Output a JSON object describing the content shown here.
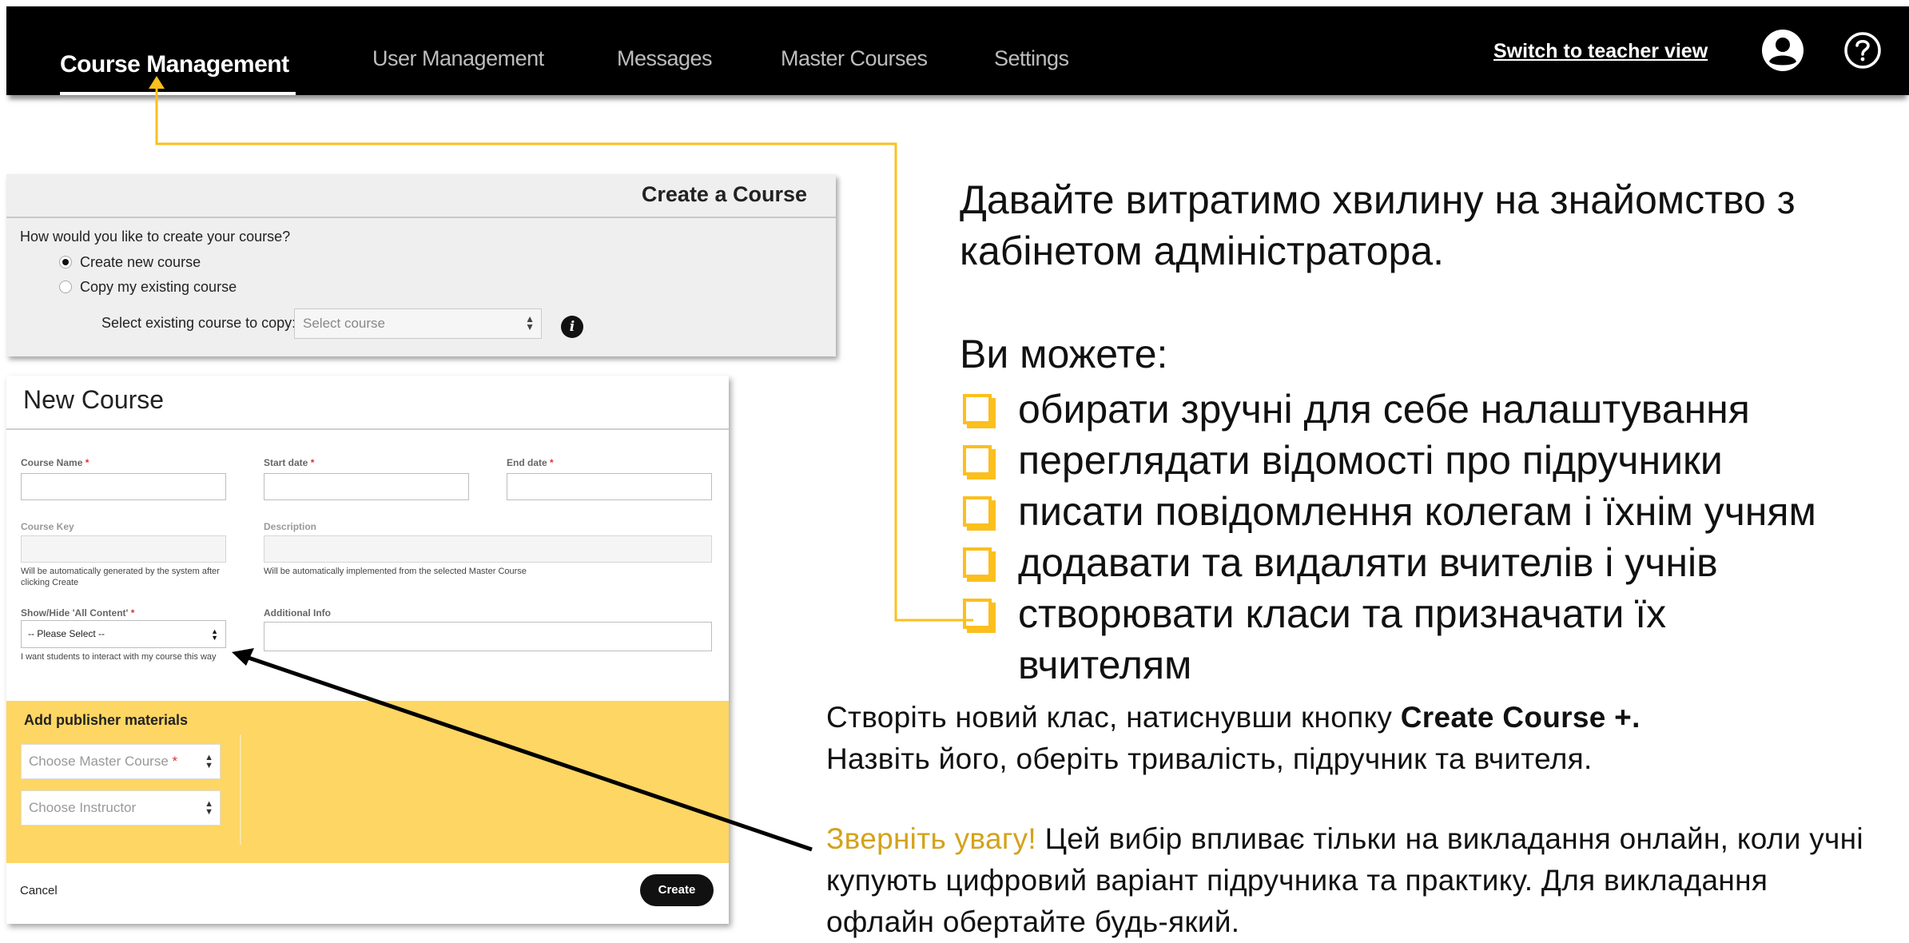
{
  "nav": {
    "items": [
      "Course Management",
      "User Management",
      "Messages",
      "Master Courses",
      "Settings"
    ],
    "switch_link": "Switch to teacher view"
  },
  "create_panel": {
    "title": "Create a Course",
    "question": "How would you like to create your course?",
    "option_new": "Create new course",
    "option_copy": "Copy my existing course",
    "selected_option": "Create new course",
    "copy_label": "Select existing course to copy:",
    "copy_placeholder": "Select course"
  },
  "new_course": {
    "title": "New Course",
    "course_name_label": "Course Name",
    "start_date_label": "Start date",
    "end_date_label": "End date",
    "course_key_label": "Course Key",
    "course_key_hint": "Will be automatically generated by the system after clicking Create",
    "description_label": "Description",
    "description_hint": "Will be automatically implemented from the selected Master Course",
    "show_hide_label": "Show/Hide 'All Content'",
    "show_hide_value": "-- Please Select --",
    "show_hide_hint": "I want students to interact with my course this way",
    "additional_info_label": "Additional Info",
    "required_mark": "*",
    "publisher_title": "Add publisher materials",
    "master_course_placeholder": "Choose Master Course",
    "instructor_placeholder": "Choose Instructor",
    "cancel_label": "Cancel",
    "create_label": "Create"
  },
  "right_text": {
    "intro": "Давайте витратимо хвилину на знайомство з кабінетом адміністратора.",
    "can": "Ви можете:",
    "bullets": [
      "обирати зручні для себе налаштування",
      "переглядати відомості про підручники",
      "писати повідомлення колегам і їхнім учням",
      "додавати та видаляти вчителів і учнів",
      "створювати класи та призначати їх вчителям"
    ],
    "instruction_pre": "Створіть новий клас, натиснувши кнопку ",
    "instruction_bold": "Create Course +.",
    "instruction_post": "Назвіть його, оберіть тривалість, підручник та вчителя.",
    "note_accent": "Зверніть увагу!",
    "note_text": " Цей вибір впливає тільки на викладання онлайн, коли учні купують цифровий варіант підручника та практику. Для викладання офлайн обертайте будь-який."
  },
  "colors": {
    "accent_yellow": "#fbbf1e",
    "publisher_bg": "#fdd663",
    "note_accent": "#d4a21a",
    "nav_bg": "#000000"
  },
  "icons": [
    "user-account-icon",
    "help-icon",
    "info-icon",
    "sort-arrows-icon",
    "checkbox-bullet-icon"
  ]
}
